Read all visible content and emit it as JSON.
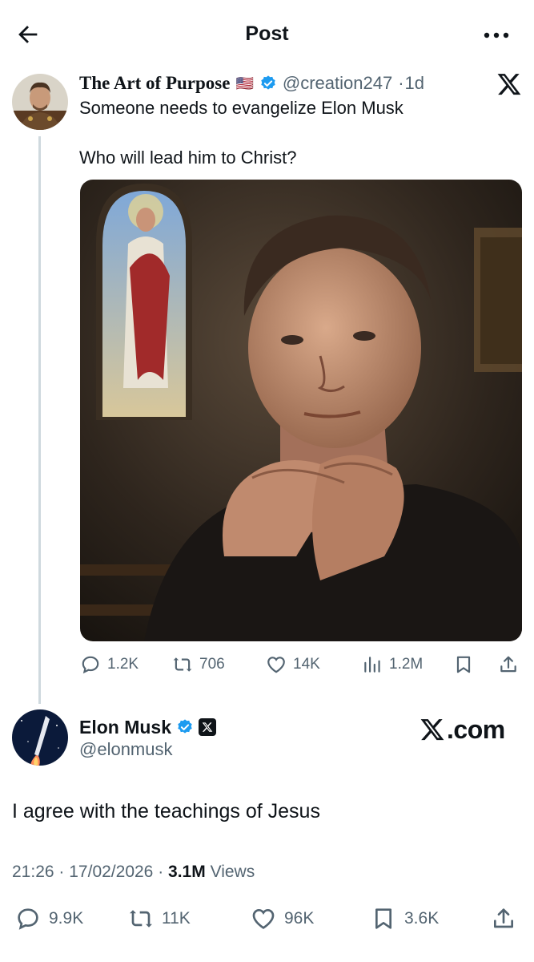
{
  "header": {
    "title": "Post",
    "back_icon": "arrow-left-icon",
    "more_icon": "more-horizontal-icon"
  },
  "parent_post": {
    "author_name": "The Art of Purpose",
    "flag": "🇺🇸",
    "handle": "@creation247",
    "separator": "·",
    "age": "1d",
    "text_line1": "Someone needs to evangelize Elon Musk",
    "text_line2": "Who will lead him to Christ?",
    "image_alt": "Man praying with clasped hands in a church, stained glass window behind",
    "stats": {
      "replies": "1.2K",
      "reposts": "706",
      "likes": "14K",
      "views": "1.2M"
    }
  },
  "main_post": {
    "author_name": "Elon Musk",
    "handle": "@elonmusk",
    "brand_text": ".com",
    "text": "I agree with the teachings of Jesus",
    "time": "21:26",
    "date": "17/02/2026",
    "dot": "·",
    "views_count": "3.1M",
    "views_label": "Views",
    "stats": {
      "replies": "9.9K",
      "reposts": "11K",
      "likes": "96K",
      "bookmarks": "3.6K"
    }
  },
  "colors": {
    "verified": "#1d9bf0",
    "muted": "#536471",
    "text": "#0f1419",
    "line": "#cfd9de"
  }
}
